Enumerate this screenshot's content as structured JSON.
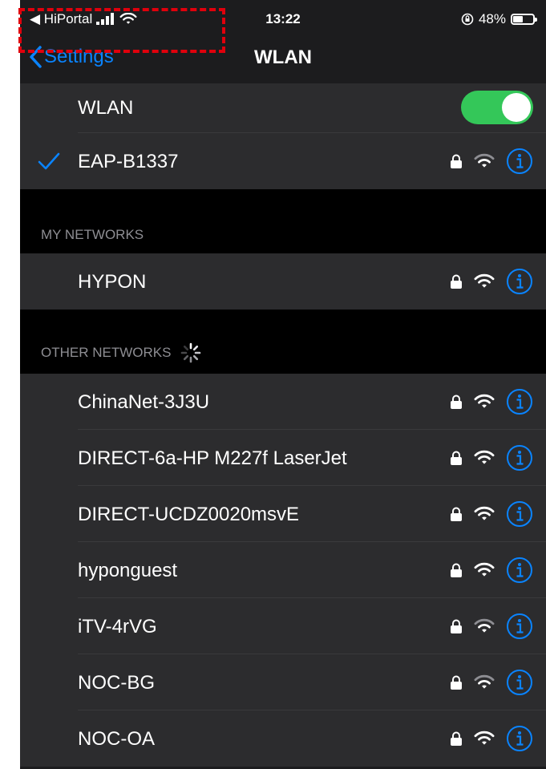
{
  "statusbar": {
    "back_app": "◀ HiPortal",
    "time": "13:22",
    "battery_pct": "48%",
    "battery_level": 0.48
  },
  "navbar": {
    "back_label": "Settings",
    "title": "WLAN"
  },
  "wlan": {
    "label": "WLAN",
    "enabled": true
  },
  "connected": {
    "name": "EAP-B1337"
  },
  "my_networks": {
    "header": "MY NETWORKS",
    "items": [
      {
        "name": "HYPON"
      }
    ]
  },
  "other_networks": {
    "header": "OTHER NETWORKS",
    "items": [
      {
        "name": "ChinaNet-3J3U"
      },
      {
        "name": "DIRECT-6a-HP M227f LaserJet"
      },
      {
        "name": "DIRECT-UCDZ0020msvE"
      },
      {
        "name": "hyponguest"
      },
      {
        "name": "iTV-4rVG"
      },
      {
        "name": "NOC-BG"
      },
      {
        "name": "NOC-OA"
      }
    ]
  },
  "colors": {
    "accent": "#0a84ff",
    "toggle_on": "#34c759",
    "highlight": "#e0000c"
  }
}
